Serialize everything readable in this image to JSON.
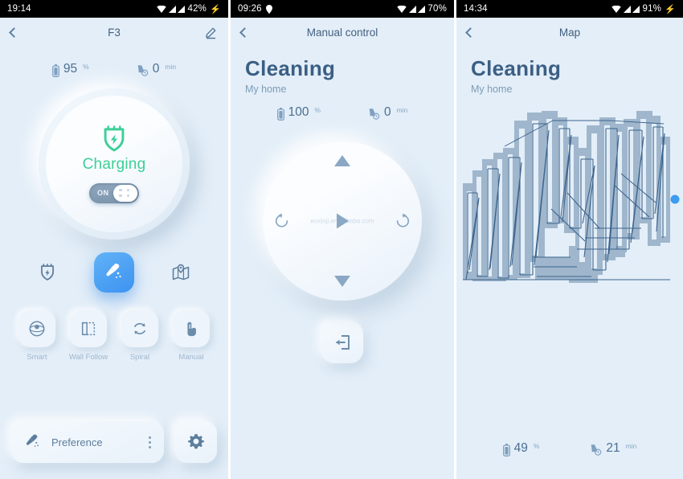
{
  "panels": [
    {
      "status": {
        "time": "19:14",
        "battery": "42%",
        "charging": true,
        "has_location": false
      },
      "titlebar": {
        "back": "back-arrow",
        "title": "F3",
        "edit": "edit-icon"
      },
      "stats": [
        {
          "icon": "battery-icon",
          "value": "95",
          "unit": "%"
        },
        {
          "icon": "clean-time-icon",
          "value": "0",
          "unit": "min"
        }
      ],
      "status_circle": {
        "icon": "charge-plug-icon",
        "label": "Charging",
        "toggle_state": "ON",
        "accent": "#3ccf97"
      },
      "actions": [
        {
          "name": "dock-charge-icon",
          "label": ""
        },
        {
          "name": "start-clean-button",
          "label": ""
        },
        {
          "name": "map-pin-icon",
          "label": ""
        }
      ],
      "modes": [
        {
          "icon": "smart-icon",
          "label": "Smart"
        },
        {
          "icon": "wall-follow-icon",
          "label": "Wall Follow"
        },
        {
          "icon": "spiral-icon",
          "label": "Spiral"
        },
        {
          "icon": "manual-hand-icon",
          "label": "Manual"
        }
      ],
      "bottom": {
        "pref_icon": "vacuum-icon",
        "pref_label": "Preference",
        "menu": "more-dots-icon",
        "gear": "gear-icon"
      }
    },
    {
      "status": {
        "time": "09:26",
        "battery": "70%",
        "charging": false,
        "has_location": true
      },
      "titlebar": {
        "back": "back-arrow",
        "title": "Manual control",
        "edit": ""
      },
      "hero": {
        "title": "Cleaning",
        "subtitle": "My home"
      },
      "stats": [
        {
          "icon": "battery-icon",
          "value": "100",
          "unit": "%"
        },
        {
          "icon": "clean-time-icon",
          "value": "0",
          "unit": "min"
        }
      ],
      "dpad": {
        "up": "arrow-up-icon",
        "down": "arrow-down-icon",
        "left": "rotate-left-icon",
        "right": "rotate-right-icon",
        "center": "play-icon",
        "watermark": "eoxinji.en.alibaba.com"
      },
      "dock_button": "return-to-dock-icon"
    },
    {
      "status": {
        "time": "14:34",
        "battery": "91%",
        "charging": true,
        "has_location": false
      },
      "titlebar": {
        "back": "back-arrow",
        "title": "Map",
        "edit": ""
      },
      "hero": {
        "title": "Cleaning",
        "subtitle": "My home"
      },
      "map": {
        "coverage_color": "#9fb6cc",
        "path_color": "#3d648d",
        "robot_marker_color": "#3d9bf0",
        "marker_label": "robot-position-marker"
      },
      "stats": [
        {
          "icon": "battery-icon",
          "value": "49",
          "unit": "%"
        },
        {
          "icon": "clean-time-icon",
          "value": "21",
          "unit": "min"
        }
      ]
    }
  ],
  "colors": {
    "background": "#e3eef8",
    "text_dark": "#3b5f84",
    "text_muted": "#8aa8c4",
    "accent_blue": "#3d93f0",
    "accent_green": "#3ccf97"
  }
}
